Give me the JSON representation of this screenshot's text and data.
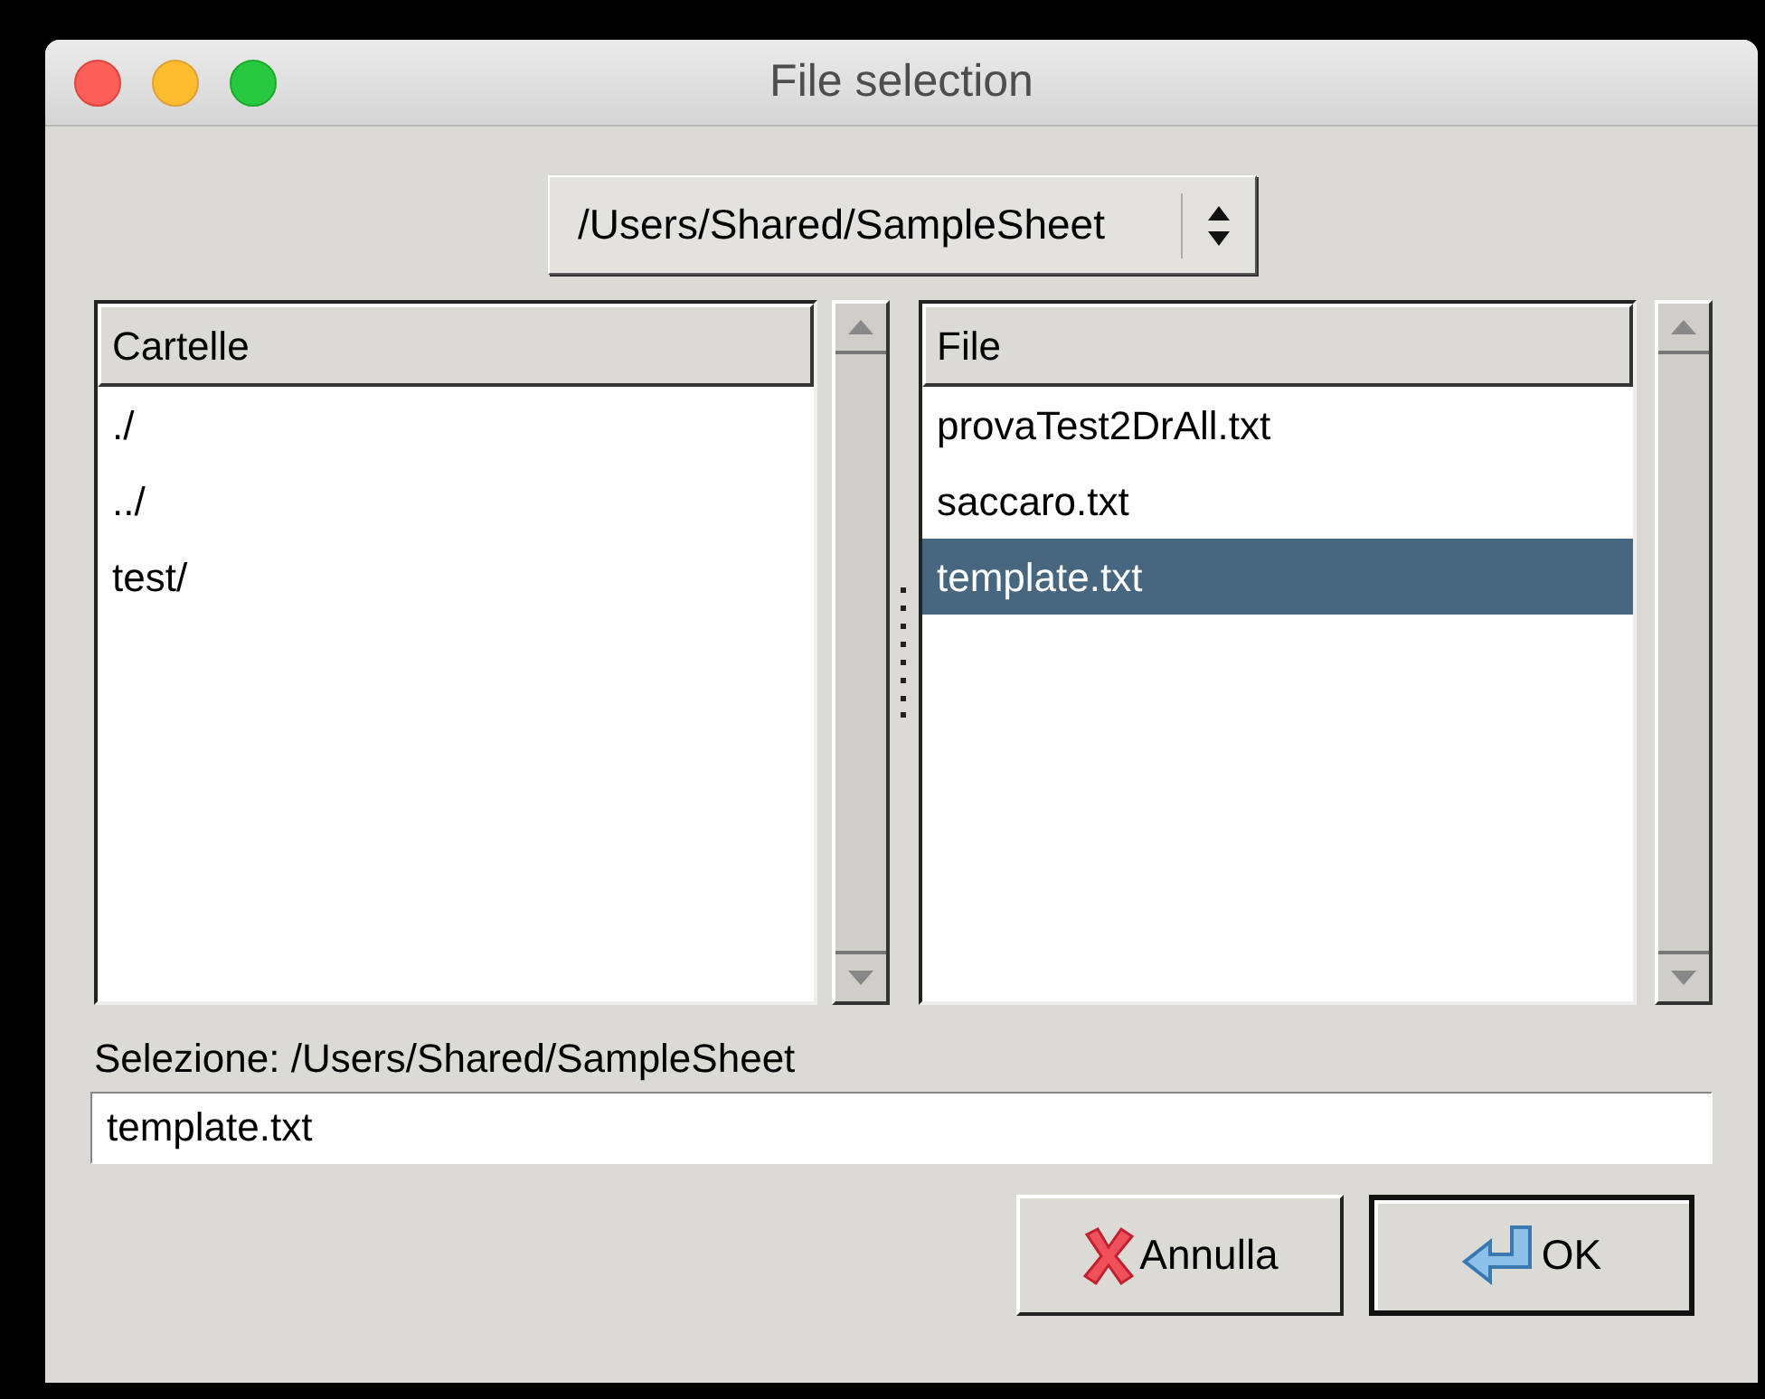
{
  "window": {
    "title": "File selection"
  },
  "path_selector": {
    "value": "/Users/Shared/SampleSheet"
  },
  "folders": {
    "header": "Cartelle",
    "items": [
      {
        "label": "./",
        "selected": false
      },
      {
        "label": "../",
        "selected": false
      },
      {
        "label": "test/",
        "selected": false
      }
    ]
  },
  "files": {
    "header": "File",
    "items": [
      {
        "label": "provaTest2DrAll.txt",
        "selected": false
      },
      {
        "label": "saccaro.txt",
        "selected": false
      },
      {
        "label": "template.txt",
        "selected": true
      }
    ]
  },
  "selection": {
    "label": "Selezione: /Users/Shared/SampleSheet",
    "value": "template.txt"
  },
  "buttons": [
    {
      "label": "Annulla",
      "kind": "cancel",
      "default": false
    },
    {
      "label": "OK",
      "kind": "ok",
      "default": true
    }
  ]
}
